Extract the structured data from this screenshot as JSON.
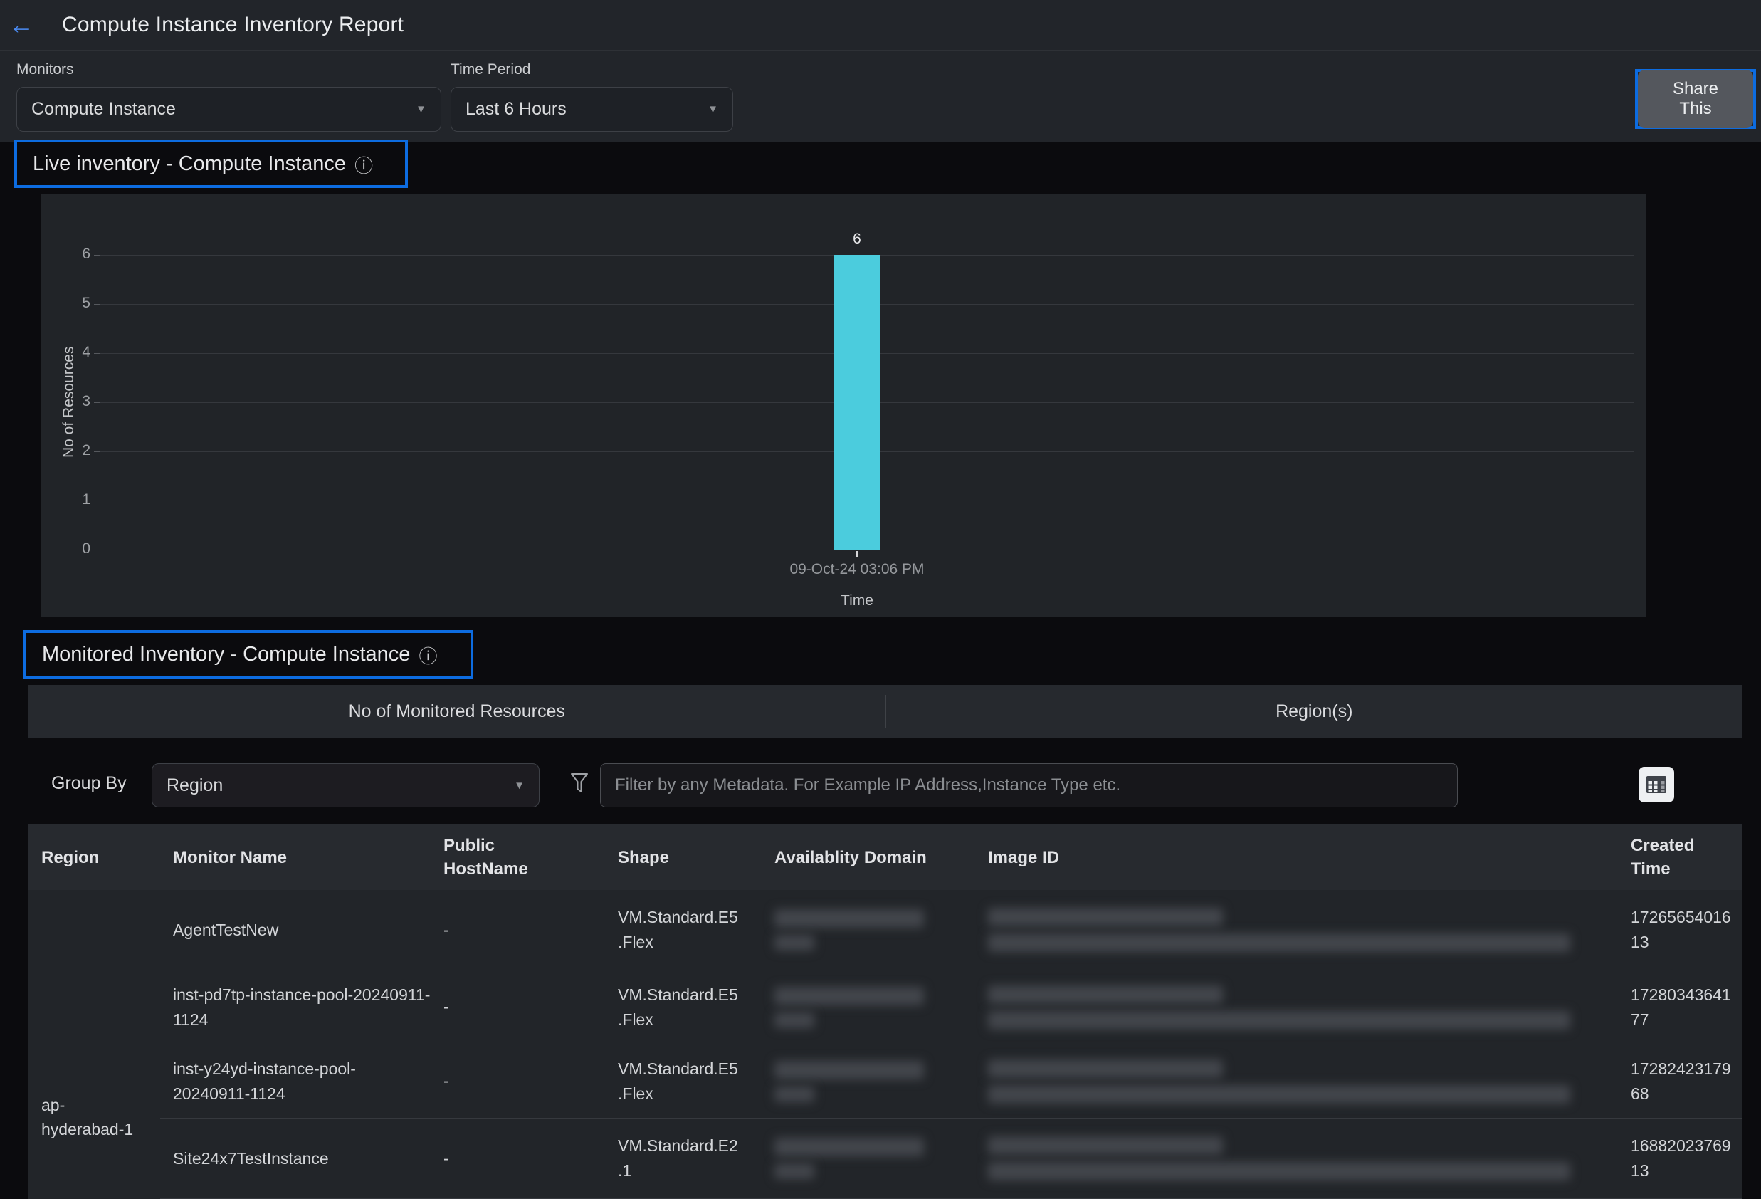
{
  "header": {
    "title": "Compute Instance Inventory Report"
  },
  "icons": {
    "back": "←",
    "caret": "▼",
    "info": "ⓘ"
  },
  "filters": {
    "monitors_label": "Monitors",
    "monitors_value": "Compute Instance",
    "time_period_label": "Time Period",
    "time_period_value": "Last 6 Hours",
    "share_button_label": "Share This"
  },
  "live_inventory": {
    "title": "Live inventory - Compute Instance"
  },
  "chart_data": {
    "type": "bar",
    "title": "Live inventory - Compute Instance",
    "categories": [
      "09-Oct-24 03:06 PM"
    ],
    "values": [
      6
    ],
    "bar_labels": [
      "6"
    ],
    "xlabel": "Time",
    "ylabel": "No of Resources",
    "ylim": [
      0,
      6
    ],
    "yticks": [
      0,
      1,
      2,
      3,
      4,
      5,
      6
    ],
    "grid": true,
    "legend_position": "none",
    "bar_color": "#4bccdd"
  },
  "monitored_inventory": {
    "title": "Monitored Inventory - Compute Instance"
  },
  "summary_table": {
    "columns": [
      "No of Monitored Resources",
      "Region(s)"
    ]
  },
  "toolbar": {
    "group_by_label": "Group By",
    "group_by_value": "Region",
    "filter_placeholder": "Filter by any Metadata. For Example IP Address,Instance Type etc."
  },
  "inventory_table": {
    "columns": [
      "Region",
      "Monitor Name",
      "Public HostName",
      "Shape",
      "Availablity Domain",
      "Image ID",
      "Created Time"
    ],
    "region_group": "ap-hyderabad-1",
    "rows": [
      {
        "monitor_name": "AgentTestNew",
        "public_hostname": "-",
        "shape": "VM.Standard.E5.Flex",
        "availability_domain_redacted": true,
        "image_id_redacted": true,
        "created_time": "1726565401613"
      },
      {
        "monitor_name": "inst-pd7tp-instance-pool-20240911-1124",
        "public_hostname": "-",
        "shape": "VM.Standard.E5.Flex",
        "availability_domain_redacted": true,
        "image_id_redacted": true,
        "created_time": "1728034364177"
      },
      {
        "monitor_name": "inst-y24yd-instance-pool-20240911-1124",
        "public_hostname": "-",
        "shape": "VM.Standard.E5.Flex",
        "availability_domain_redacted": true,
        "image_id_redacted": true,
        "created_time": "1728242317968"
      },
      {
        "monitor_name": "Site24x7TestInstance",
        "public_hostname": "-",
        "shape": "VM.Standard.E2.1",
        "availability_domain_redacted": true,
        "image_id_redacted": true,
        "created_time": "1688202376913"
      }
    ]
  },
  "colors": {
    "accent_blue": "#0d6ce0",
    "bar_cyan": "#4bccdd"
  }
}
